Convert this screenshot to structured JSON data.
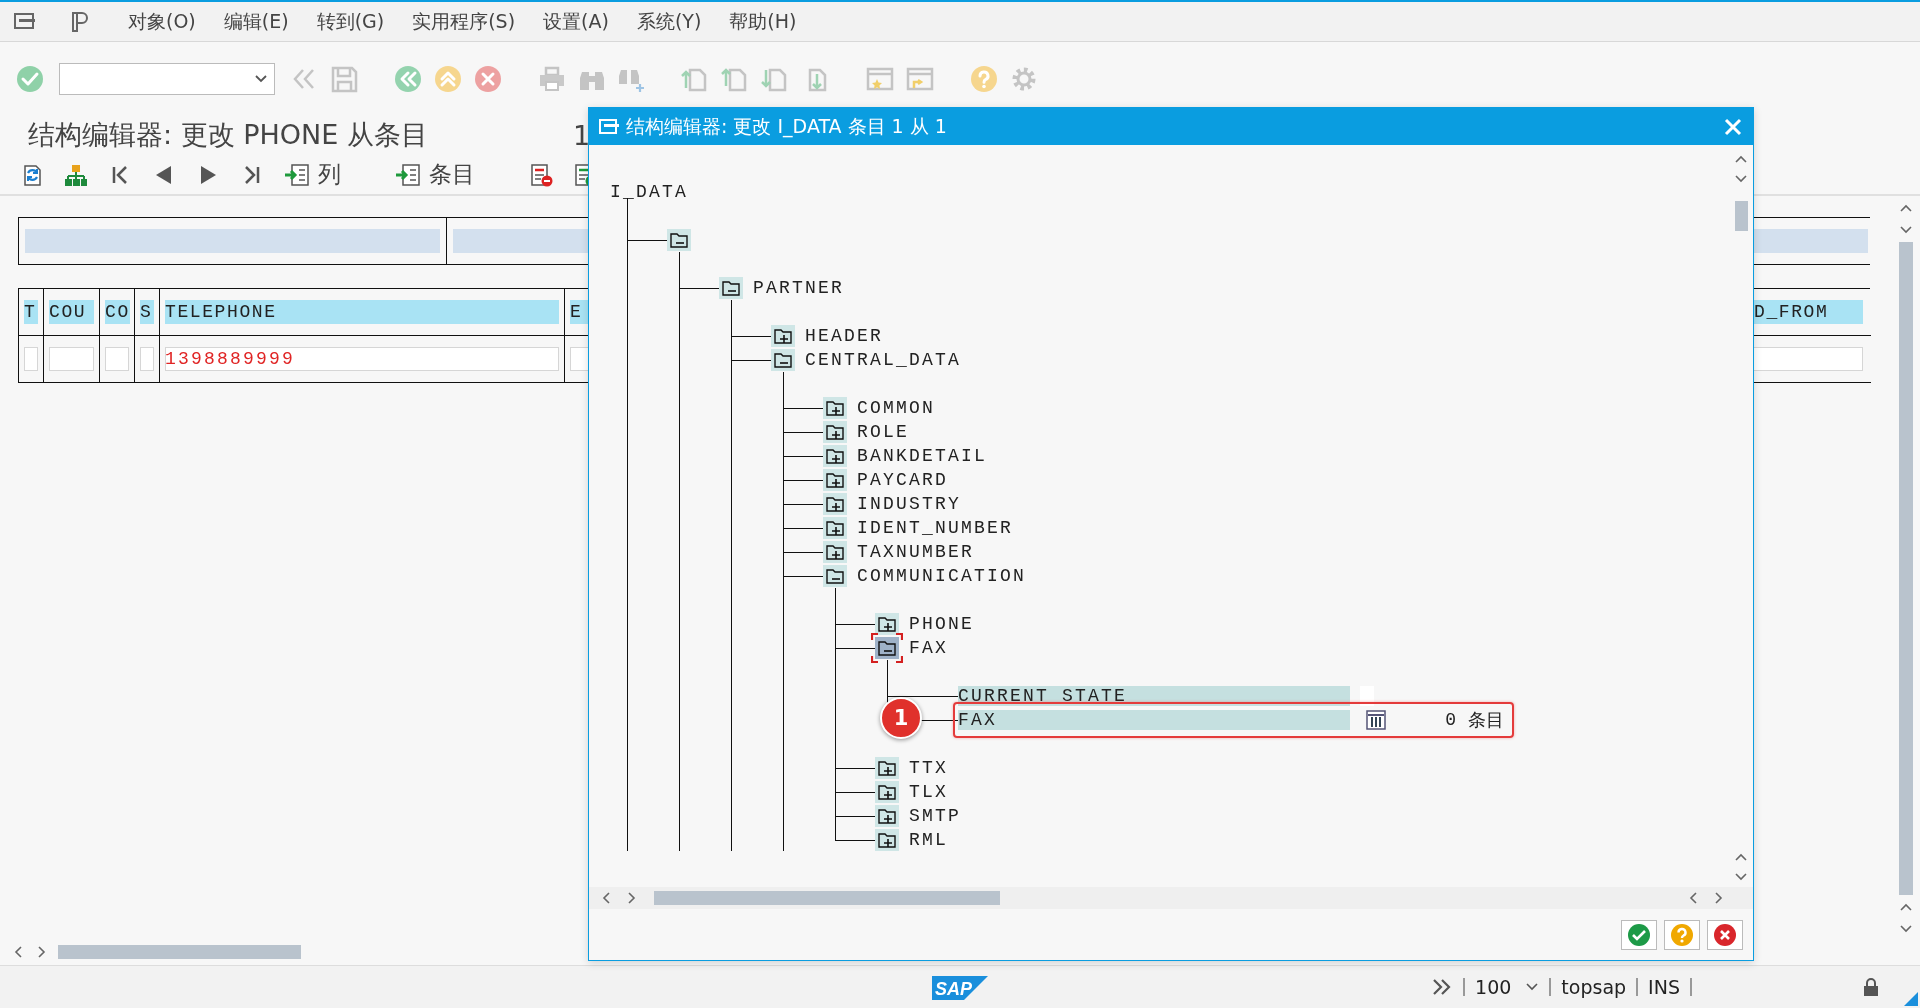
{
  "menu": [
    "对象(O)",
    "编辑(E)",
    "转到(G)",
    "实用程序(S)",
    "设置(A)",
    "系统(Y)",
    "帮助(H)"
  ],
  "screen": {
    "title": "结构编辑器: 更改 PHONE 从条目",
    "title_counter": "1",
    "app_toolbar": {
      "columns_label": "列",
      "entries_label": "条目"
    },
    "table": {
      "columns": [
        "T",
        "COU",
        "CO",
        "S",
        "TELEPHONE",
        "E",
        "D_FROM"
      ],
      "rows": [
        {
          "telephone": "1398889999"
        }
      ]
    }
  },
  "dialog": {
    "title": "结构编辑器: 更改 I_DATA 条目 1 从 1",
    "tree": {
      "label": "I_DATA",
      "children": [
        {
          "expanded": true,
          "children": [
            {
              "label": "PARTNER",
              "expanded": true,
              "children": [
                {
                  "label": "HEADER",
                  "expanded": false
                },
                {
                  "label": "CENTRAL_DATA",
                  "expanded": true,
                  "children": [
                    {
                      "label": "COMMON",
                      "expanded": false
                    },
                    {
                      "label": "ROLE",
                      "expanded": false
                    },
                    {
                      "label": "BANKDETAIL",
                      "expanded": false
                    },
                    {
                      "label": "PAYCARD",
                      "expanded": false
                    },
                    {
                      "label": "INDUSTRY",
                      "expanded": false
                    },
                    {
                      "label": "IDENT_NUMBER",
                      "expanded": false
                    },
                    {
                      "label": "TAXNUMBER",
                      "expanded": false
                    },
                    {
                      "label": "COMMUNICATION",
                      "expanded": true,
                      "children": [
                        {
                          "label": "PHONE",
                          "expanded": false
                        },
                        {
                          "label": "FAX",
                          "expanded": true,
                          "focused": true,
                          "children": [
                            {
                              "kind": "field",
                              "label": "CURRENT_STATE"
                            },
                            {
                              "kind": "table",
                              "label": "FAX",
                              "count": "0",
                              "unit": "条目",
                              "annotation": "1"
                            }
                          ]
                        },
                        {
                          "label": "TTX",
                          "expanded": false
                        },
                        {
                          "label": "TLX",
                          "expanded": false
                        },
                        {
                          "label": "SMTP",
                          "expanded": false
                        },
                        {
                          "label": "RML",
                          "expanded": false
                        }
                      ]
                    }
                  ]
                }
              ]
            }
          ]
        }
      ]
    }
  },
  "status_bar": {
    "logo": "SAP",
    "zoom": "100",
    "server": "topsap",
    "mode": "INS"
  }
}
